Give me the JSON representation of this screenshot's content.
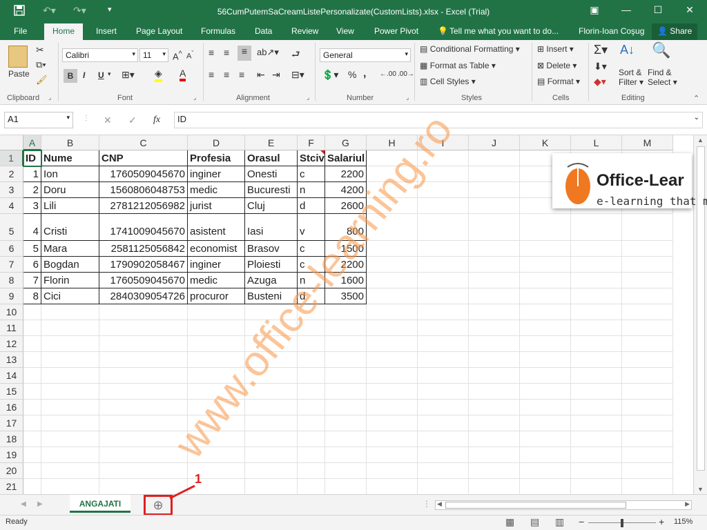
{
  "window": {
    "title": "56CumPutemSaCreamListePersonalizate(CustomLists).xlsx - Excel (Trial)"
  },
  "quick_access": {
    "save_icon": "save-icon",
    "undo_icon": "undo-icon",
    "redo_icon": "redo-icon",
    "customize_icon": "customize-qat-icon"
  },
  "ribbon_tabs": [
    "File",
    "Home",
    "Insert",
    "Page Layout",
    "Formulas",
    "Data",
    "Review",
    "View",
    "Power Pivot"
  ],
  "tell_me": "Tell me what you want to do...",
  "user": "Florin-Ioan Coşug",
  "share": "Share",
  "clipboard": {
    "paste": "Paste",
    "label": "Clipboard"
  },
  "font": {
    "name": "Calibri",
    "size": "11",
    "bold": "B",
    "italic": "I",
    "underline": "U",
    "label": "Font"
  },
  "alignment": {
    "label": "Alignment"
  },
  "number": {
    "format": "General",
    "percent": "%",
    "comma": ",",
    "label": "Number"
  },
  "styles": {
    "conditional": "Conditional Formatting",
    "format_table": "Format as Table",
    "cell_styles": "Cell Styles",
    "label": "Styles"
  },
  "cells": {
    "insert": "Insert",
    "delete": "Delete",
    "format": "Format",
    "label": "Cells"
  },
  "editing": {
    "sort": "Sort &",
    "filter": "Filter",
    "find": "Find &",
    "select": "Select",
    "label": "Editing"
  },
  "formula_bar": {
    "name_box": "A1",
    "fx": "fx",
    "content": "ID"
  },
  "columns": [
    "A",
    "B",
    "C",
    "D",
    "E",
    "F",
    "G",
    "H",
    "I",
    "J",
    "K",
    "L",
    "M"
  ],
  "rows": [
    "1",
    "2",
    "3",
    "4",
    "5",
    "6",
    "7",
    "8",
    "9",
    "10",
    "11",
    "12",
    "13",
    "14",
    "15",
    "16",
    "17",
    "18",
    "19",
    "20",
    "21"
  ],
  "table": {
    "headers": [
      "ID",
      "Nume",
      "CNP",
      "Profesia",
      "Orasul",
      "Stciv",
      "Salariul"
    ],
    "data": [
      [
        "1",
        "Ion",
        "1760509045670",
        "inginer",
        "Onesti",
        "c",
        "2200"
      ],
      [
        "2",
        "Doru",
        "1560806048753",
        "medic",
        "Bucuresti",
        "n",
        "4200"
      ],
      [
        "3",
        "Lili",
        "2781212056982",
        "jurist",
        "Cluj",
        "d",
        "2600"
      ],
      [
        "4",
        "Cristi",
        "1741009045670",
        "asistent",
        "Iasi",
        "v",
        "800"
      ],
      [
        "5",
        "Mara",
        "2581125056842",
        "economist",
        "Brasov",
        "c",
        "1500"
      ],
      [
        "6",
        "Bogdan",
        "1790902058467",
        "inginer",
        "Ploiesti",
        "c",
        "2200"
      ],
      [
        "7",
        "Florin",
        "1760509045670",
        "medic",
        "Azuga",
        "n",
        "1600"
      ],
      [
        "8",
        "Cici",
        "2840309054726",
        "procuror",
        "Busteni",
        "d",
        "3500"
      ]
    ]
  },
  "logo": {
    "brand": "Office-Lear",
    "tagline": "e-learning that m"
  },
  "watermark": "www.office-learning.ro",
  "sheet_tab": "ANGAJATI",
  "annotation": "1",
  "status": {
    "ready": "Ready",
    "zoom": "115%"
  }
}
